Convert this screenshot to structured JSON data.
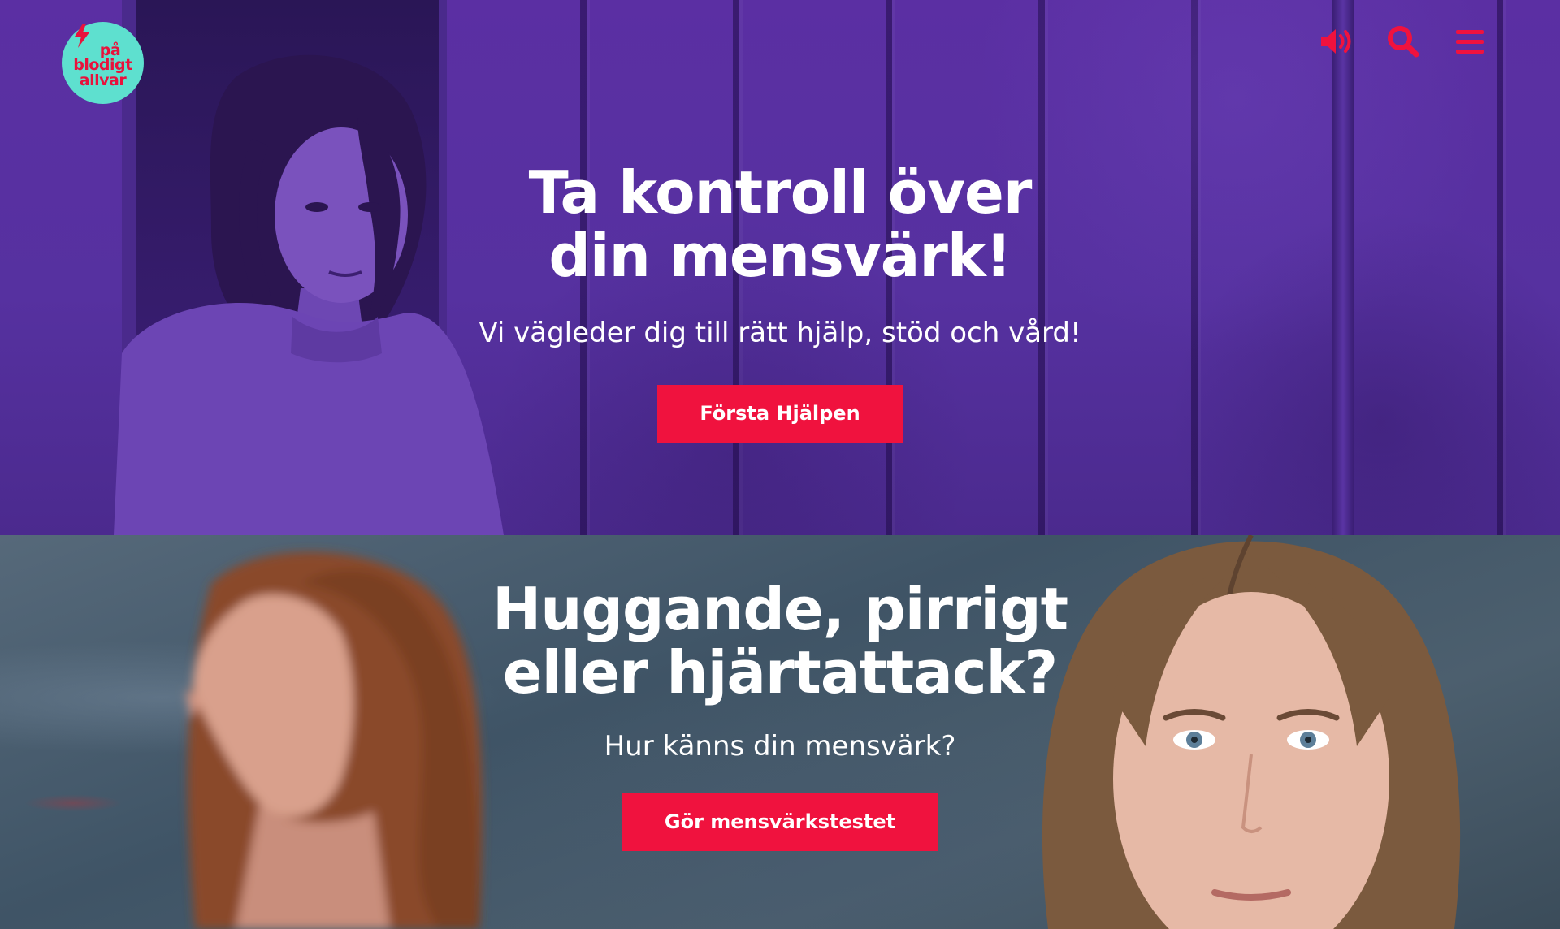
{
  "brand": {
    "logo_lines": [
      "på",
      "blodigt",
      "allvar"
    ],
    "logo_bg": "#5ee0cf",
    "logo_fg": "#e8123c"
  },
  "header": {
    "icons": [
      "speaker-icon",
      "search-icon",
      "menu-icon"
    ],
    "icon_color": "#f0123e"
  },
  "hero1": {
    "title_line1": "Ta kontroll över",
    "title_line2": "din mensvärk!",
    "lead": "Vi vägleder dig till rätt hjälp, stöd och vård!",
    "cta_label": "Första Hjälpen",
    "overlay_color": "#5a2f9e"
  },
  "hero2": {
    "title_line1": "Huggande, pirrigt",
    "title_line2": "eller hjärtattack?",
    "lead": "Hur känns din mensvärk?",
    "cta_label": "Gör mensvärkstestet"
  },
  "accent": "#f0123e"
}
